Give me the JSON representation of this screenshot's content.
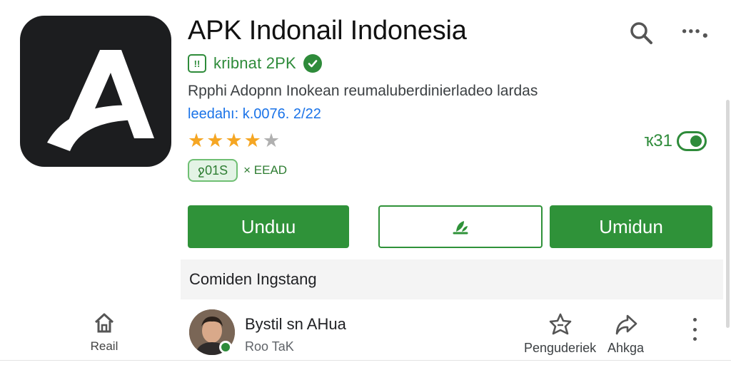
{
  "app": {
    "title": "APK Indonail Indonesia",
    "developer": "kribnat 2PK",
    "developer_badge": "!!",
    "description": "Rpphi Adopnn Inokean reumaluberdinierladeo lardas",
    "meta": "leedahı: k.0076. 2/22",
    "rating_stars": 3.5,
    "right_stat": "ҡ31",
    "chip_label": "ջ01S",
    "chip_extra": "× EEAD"
  },
  "buttons": {
    "primary_left": "Unduu",
    "primary_right": "Umidun"
  },
  "section": {
    "title": "Comiden Ingstang"
  },
  "bottom_nav": {
    "home_label": "Reail"
  },
  "user": {
    "name": "Bystil sn AHua",
    "subtitle": "Roo TaK"
  },
  "actions": [
    {
      "label": "Penguderiek",
      "icon": "bookmark-icon"
    },
    {
      "label": "Ahkga",
      "icon": "share-icon"
    }
  ],
  "colors": {
    "accent": "#2f9239",
    "star": "#f5a623",
    "link": "#1a73e8",
    "icon_bg": "#1c1d1f"
  }
}
